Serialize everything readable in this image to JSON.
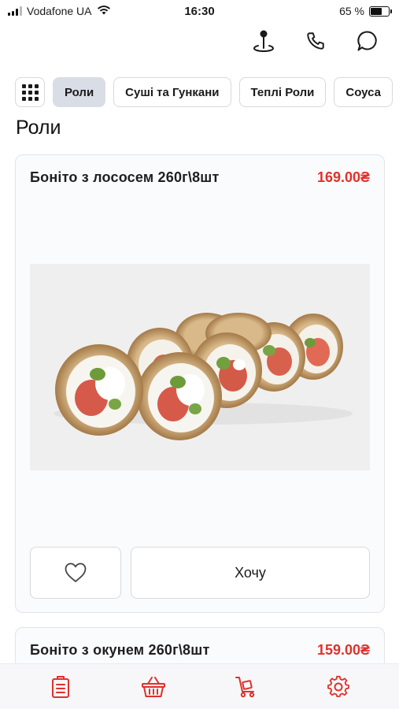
{
  "status_bar": {
    "carrier": "Vodafone UA",
    "time": "16:30",
    "battery": "65 %",
    "battery_level": 0.65
  },
  "header": {
    "icons": [
      "map-pin-icon",
      "phone-icon",
      "chat-icon"
    ]
  },
  "categories": {
    "grid_icon": "grid-icon",
    "items": [
      {
        "label": "Роли",
        "active": true
      },
      {
        "label": "Суші та Гункани",
        "active": false
      },
      {
        "label": "Теплі Роли",
        "active": false
      },
      {
        "label": "Соуса",
        "active": false
      }
    ]
  },
  "section": {
    "title": "Роли"
  },
  "products": [
    {
      "name": "Боніто з лососем 260г\\8шт",
      "price": "169.00₴",
      "image": "sushi-roll-image",
      "want_label": "Хочу"
    },
    {
      "name": "Боніто з окунем 260г\\8шт",
      "price": "159.00₴"
    }
  ],
  "bottom_nav": {
    "icons": [
      "menu-list-icon",
      "basket-icon",
      "delivery-cart-icon",
      "settings-icon"
    ]
  },
  "colors": {
    "accent": "#e0312b",
    "active_chip": "#d9dde6",
    "card_bg": "#fafbfd"
  }
}
